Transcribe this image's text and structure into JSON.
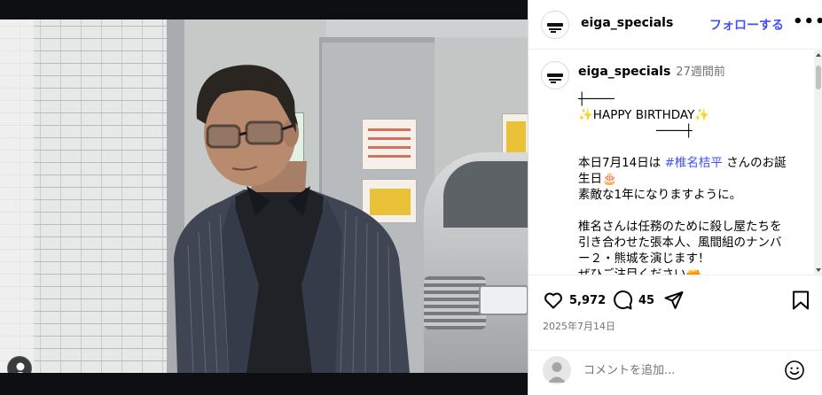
{
  "post": {
    "account": "eiga_specials",
    "follow_label": "フォローする",
    "more_label": "•••",
    "logo_icon": "eiga-specials-logo",
    "caption": {
      "username": "eiga_specials",
      "time_ago": "27週間前",
      "rule_left": "┼────",
      "birthday_line": "✨HAPPY BIRTHDAY✨",
      "rule_right": "────┼",
      "line1_prefix": "本日7月14日は ",
      "hashtag": "#椎名桔平",
      "line1_suffix": " さんのお誕",
      "line2": "生日🎂",
      "line3": "素敵な1年になりますように。",
      "line4": "椎名さんは任務のために殺し屋たちを",
      "line5": "引き合わせた張本人、風間組のナンバ",
      "line6": "ー２・熊城を演じます！",
      "line7": "ぜひご注目ください🔫"
    },
    "likes": "5,972",
    "comments": "45",
    "date": "2025年7月14日",
    "comment_placeholder": "コメントを追加...",
    "icons": {
      "like": "heart-icon",
      "comment": "comment-icon",
      "share": "send-icon",
      "save": "bookmark-icon",
      "emoji": "smiley-icon",
      "tagged_user": "person-icon"
    }
  },
  "colors": {
    "link_blue": "#4150f7",
    "muted_gray": "#737373",
    "divider": "#efefef",
    "media_background": "#0e0f12"
  }
}
